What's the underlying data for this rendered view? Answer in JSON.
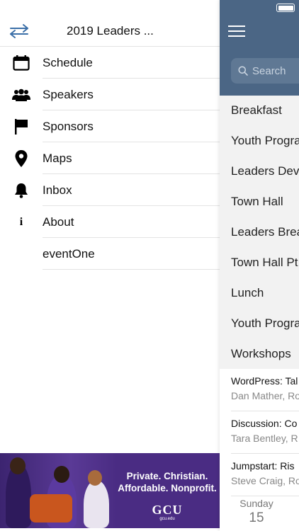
{
  "drawer": {
    "title": "2019 Leaders ...",
    "menu": [
      {
        "label": "Schedule",
        "icon": "calendar-icon"
      },
      {
        "label": "Speakers",
        "icon": "people-icon"
      },
      {
        "label": "Sponsors",
        "icon": "flag-icon"
      },
      {
        "label": "Maps",
        "icon": "map-pin-icon"
      },
      {
        "label": "Inbox",
        "icon": "bell-icon"
      },
      {
        "label": "About",
        "icon": "info-icon"
      },
      {
        "label": "eventOne",
        "icon": ""
      }
    ]
  },
  "ad": {
    "line1": "Private. Christian.",
    "line2": "Affordable. Nonprofit.",
    "logo": "GCU",
    "url": "gcu.edu"
  },
  "main": {
    "header_color": "#4b6685",
    "search_placeholder": "Search",
    "categories": [
      "Breakfast",
      "Youth Progra",
      "Leaders Dev",
      "Town Hall",
      "Leaders Brea",
      "Town Hall Pt",
      "Lunch",
      "Youth Progra",
      "Workshops"
    ],
    "sessions": [
      {
        "title": "WordPress: Tal",
        "speaker": "Dan Mather, Ro"
      },
      {
        "title": "Discussion: Co",
        "speaker": "Tara Bentley, R"
      },
      {
        "title": "Jumpstart: Ris",
        "speaker": "Steve Craig, Ro"
      }
    ],
    "date": {
      "day": "Sunday",
      "num": "15"
    }
  }
}
